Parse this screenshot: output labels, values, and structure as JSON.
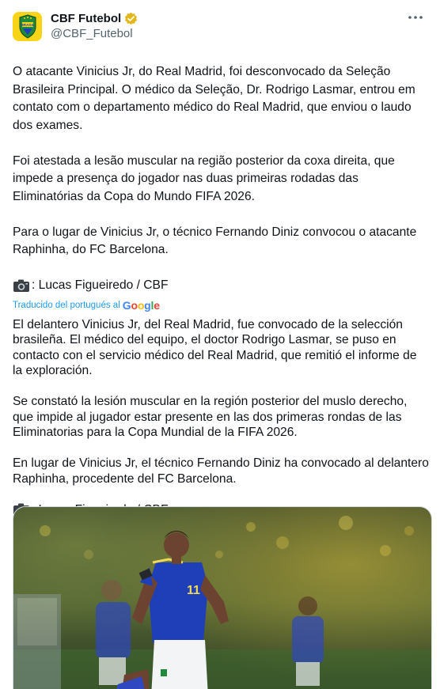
{
  "author": {
    "display_name": "CBF Futebol",
    "handle": "@CBF_Futebol",
    "verified_icon": "verified-gold-badge-icon",
    "avatar_icon": "cbf-crest-logo",
    "avatar_text": "BRASIL",
    "avatar_color": "#f7d417",
    "badge_color": "#e2b719"
  },
  "more_icon": "more-options-icon",
  "original": {
    "paragraphs": [
      "O atacante Vinicius Jr, do Real Madrid, foi desconvocado da Seleção Brasileira Principal. O médico da Seleção, Dr. Rodrigo Lasmar, entrou em contato com o departamento médico do Real Madrid, que enviou o laudo dos exames.",
      "Foi atestada a lesão muscular na região posterior da coxa direita, que impede a presença  do jogador nas duas primeiras rodadas das Eliminatórias da Copa do Mundo FIFA 2026.",
      "Para o lugar de Vinicius Jr, o técnico Fernando Diniz convocou o atacante Raphinha, do FC Barcelona."
    ],
    "credit": ": Lucas Figueiredo / CBF",
    "credit_icon": "camera-icon"
  },
  "translation": {
    "label": "Traducido del portugués al",
    "provider": "Google",
    "paragraphs": [
      "El delantero Vinicius Jr, del Real Madrid, fue convocado de la selección brasileña. El médico del equipo, el doctor Rodrigo Lasmar, se puso en contacto con el servicio médico del Real Madrid, que remitió el informe de la exploración.",
      "Se constató la lesión muscular en la región posterior del muslo derecho, que impide al jugador estar presente en las dos primeras rondas de las Eliminatorias para la Copa Mundial de la FIFA 2026.",
      "En lugar de Vinicius Jr, el técnico Fernando Diniz ha convocado al delantero Raphinha, procedente del FC Barcelona."
    ],
    "credit": ": Lucas Figueiredo / CBF",
    "credit_icon": "camera-icon"
  },
  "media": {
    "icon": "photo-football-player",
    "jersey_number": "11"
  },
  "colors": {
    "text": "#0f1419",
    "secondary": "#536471",
    "link": "#1d9bf0",
    "jersey_blue": "#1f3fb8"
  }
}
